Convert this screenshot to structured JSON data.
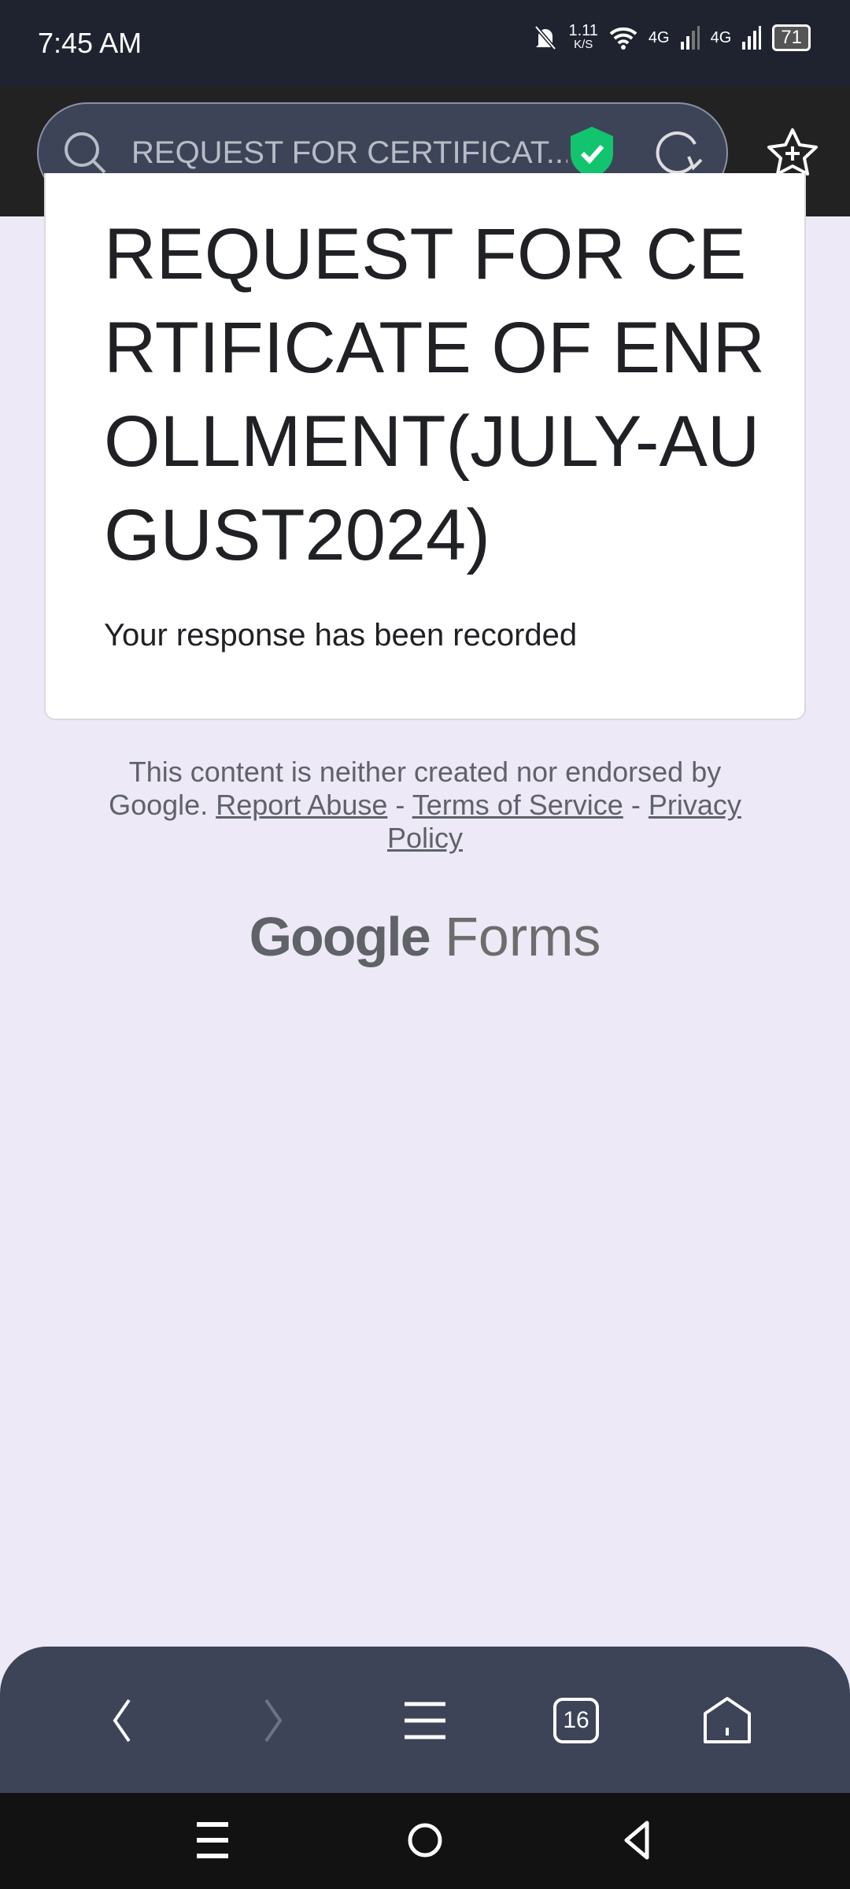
{
  "status_bar": {
    "time": "7:45 AM",
    "net_speed_value": "1.11",
    "net_speed_unit": "K/S",
    "network1": "4G",
    "network2": "4G",
    "battery": "71"
  },
  "browser": {
    "address_text": "REQUEST FOR CERTIFICAT...",
    "tab_count": "16"
  },
  "form": {
    "title": "REQUEST FOR CERTIFICATE OF ENROLLMENT(JULY-AUGUST2024)",
    "message": "Your response has been recorded"
  },
  "footer": {
    "disclaimer": "This content is neither created nor endorsed by Google.",
    "report_abuse": "Report Abuse",
    "sep": "-",
    "terms": "Terms of Service",
    "privacy": "Privacy Policy"
  },
  "logo": {
    "google": "Google",
    "forms": "Forms"
  }
}
